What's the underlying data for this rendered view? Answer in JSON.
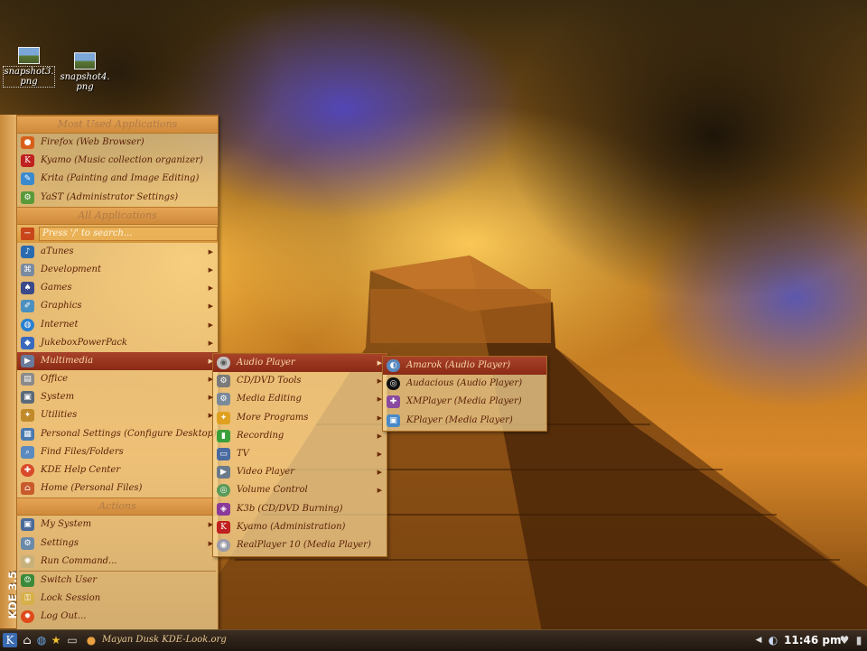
{
  "desktop": {
    "icons": [
      {
        "label_line1": "snapshot3.",
        "label_line2": "png"
      },
      {
        "label_line1": "snapshot4.",
        "label_line2": "png"
      }
    ]
  },
  "kmenu": {
    "side_label": "KDE 3.5",
    "most_used_header": "Most Used Applications",
    "most_used": [
      {
        "label": "Firefox (Web Browser)",
        "icon": "firefox-icon"
      },
      {
        "label": "Kyamo (Music collection organizer)",
        "icon": "kyamo-icon"
      },
      {
        "label": "Krita (Painting and Image Editing)",
        "icon": "krita-icon"
      },
      {
        "label": "YaST (Administrator Settings)",
        "icon": "yast-icon"
      }
    ],
    "all_apps_header": "All Applications",
    "search_placeholder": "Press '/' to search...",
    "all_apps": [
      {
        "label": "aTunes",
        "icon": "atunes-icon"
      },
      {
        "label": "Development",
        "icon": "development-icon"
      },
      {
        "label": "Games",
        "icon": "games-icon"
      },
      {
        "label": "Graphics",
        "icon": "graphics-icon"
      },
      {
        "label": "Internet",
        "icon": "internet-icon"
      },
      {
        "label": "JukeboxPowerPack",
        "icon": "jukebox-icon"
      },
      {
        "label": "Multimedia",
        "icon": "multimedia-icon"
      },
      {
        "label": "Office",
        "icon": "office-icon"
      },
      {
        "label": "System",
        "icon": "system-icon"
      },
      {
        "label": "Utilities",
        "icon": "utilities-icon"
      }
    ],
    "other_apps": [
      {
        "label": "Personal Settings (Configure Desktop)",
        "icon": "personal-settings-icon"
      },
      {
        "label": "Find Files/Folders",
        "icon": "find-files-icon"
      },
      {
        "label": "KDE Help Center",
        "icon": "help-center-icon"
      },
      {
        "label": "Home (Personal Files)",
        "icon": "home-icon"
      }
    ],
    "actions_header": "Actions",
    "actions": [
      {
        "label": "My System",
        "icon": "my-system-icon"
      },
      {
        "label": "Settings",
        "icon": "settings-icon"
      },
      {
        "label": "Run Command...",
        "icon": "run-command-icon"
      }
    ],
    "session": [
      {
        "label": "Switch User",
        "icon": "switch-user-icon"
      },
      {
        "label": "Lock Session",
        "icon": "lock-session-icon"
      },
      {
        "label": "Log Out...",
        "icon": "log-out-icon"
      }
    ]
  },
  "multimedia_menu": {
    "items": [
      {
        "label": "Audio Player",
        "icon": "audio-player-icon"
      },
      {
        "label": "CD/DVD Tools",
        "icon": "cd-dvd-icon"
      },
      {
        "label": "Media Editing",
        "icon": "media-editing-icon"
      },
      {
        "label": "More Programs",
        "icon": "more-programs-icon"
      },
      {
        "label": "Recording",
        "icon": "recording-icon"
      },
      {
        "label": "TV",
        "icon": "tv-icon"
      },
      {
        "label": "Video Player",
        "icon": "video-player-icon"
      },
      {
        "label": "Volume Control",
        "icon": "volume-control-icon"
      },
      {
        "label": "K3b (CD/DVD Burning)",
        "icon": "k3b-icon"
      },
      {
        "label": "Kyamo (Administration)",
        "icon": "kyamo-admin-icon"
      },
      {
        "label": "RealPlayer 10 (Media Player)",
        "icon": "realplayer-icon"
      }
    ]
  },
  "audio_menu": {
    "items": [
      {
        "label": "Amarok (Audio Player)",
        "icon": "amarok-icon"
      },
      {
        "label": "Audacious (Audio Player)",
        "icon": "audacious-icon"
      },
      {
        "label": "XMPlayer (Media Player)",
        "icon": "xmplayer-icon"
      },
      {
        "label": "KPlayer (Media Player)",
        "icon": "kplayer-icon"
      }
    ]
  },
  "taskbar": {
    "task_label": "Mayan Dusk KDE-Look.org",
    "clock": "11:46 pm"
  }
}
